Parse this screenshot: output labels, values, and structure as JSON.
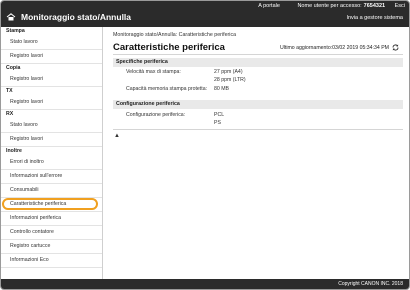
{
  "header": {
    "portal_link": "A portale",
    "user_label": "Nome utente per accesso:",
    "user_value": "7654321",
    "logout": "Esci",
    "title": "Monitoraggio stato/Annulla",
    "mail_link": "Invia a gestore sistema"
  },
  "sidebar": {
    "sections": [
      {
        "title": "Stampa",
        "items": [
          "Stato lavoro",
          "Registro lavori"
        ]
      },
      {
        "title": "Copia",
        "items": [
          "Registro lavori"
        ]
      },
      {
        "title": "TX",
        "items": [
          "Registro lavori"
        ]
      },
      {
        "title": "RX",
        "items": [
          "Stato lavoro",
          "Registro lavori"
        ]
      },
      {
        "title": "Inoltre",
        "items": [
          "Errori di inoltro",
          "Informazioni sull'errore",
          "Consumabili",
          "Caratteristiche periferica",
          "Informazioni periferica",
          "Controllo contatore",
          "Registro cartucce",
          "Informazioni Eco"
        ]
      }
    ],
    "active_item": "Caratteristiche periferica"
  },
  "main": {
    "breadcrumb": "Monitoraggio stato/Annulla: Caratteristiche periferica",
    "page_title": "Caratteristiche periferica",
    "last_update": "Ultimo aggiornamento:03/02 2019 05:34:34 PM",
    "sections": [
      {
        "title": "Specifiche periferica",
        "rows": [
          {
            "label": "Velocità max di stampa:",
            "values": [
              "27 ppm (A4)",
              "28 ppm (LTR)"
            ]
          },
          {
            "label": "Capacità memoria stampa protetta:",
            "values": [
              "80 MB"
            ]
          }
        ]
      },
      {
        "title": "Configurazione periferica",
        "rows": [
          {
            "label": "Configurazione periferica:",
            "values": [
              "PCL",
              "PS"
            ]
          }
        ]
      }
    ],
    "to_top": "▲"
  },
  "footer": {
    "copyright": "Copyright CANON INC. 2018"
  },
  "icons": {
    "home": "home-icon",
    "refresh": "refresh-icon"
  },
  "colors": {
    "topbar": "#2b2b2b",
    "highlight": "#f0a020"
  }
}
